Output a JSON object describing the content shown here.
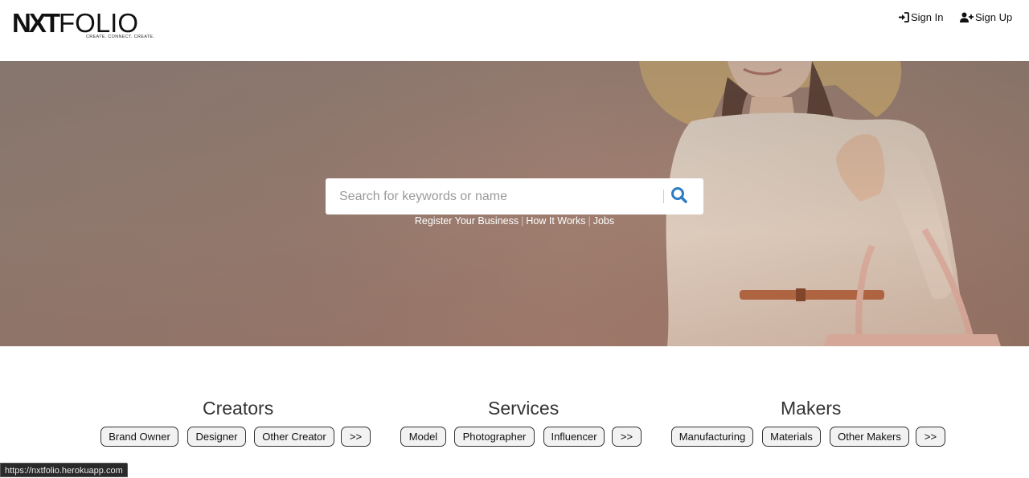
{
  "header": {
    "logo": {
      "part1": "NXT",
      "part2": "FOLIO",
      "tagline": "CREATE. CONNECT. CREATE."
    },
    "signin_label": "Sign In",
    "signup_label": "Sign Up"
  },
  "hero": {
    "search": {
      "placeholder": "Search for keywords or name",
      "value": ""
    },
    "links": [
      "Register Your Business",
      "How It Works",
      "Jobs"
    ]
  },
  "categories": [
    {
      "title": "Creators",
      "items": [
        "Brand Owner",
        "Designer",
        "Other Creator",
        ">>"
      ]
    },
    {
      "title": "Services",
      "items": [
        "Model",
        "Photographer",
        "Influencer",
        ">>"
      ]
    },
    {
      "title": "Makers",
      "items": [
        "Manufacturing",
        "Materials",
        "Other Makers",
        ">>"
      ]
    }
  ],
  "status_bar": {
    "url": "https://nxtfolio.herokuapp.com"
  },
  "colors": {
    "accent": "#2e7bc4",
    "hero_tone": "#9c7a6c"
  },
  "icons": {
    "signin": "sign-in-icon",
    "signup": "user-plus-icon",
    "search": "search-icon"
  }
}
